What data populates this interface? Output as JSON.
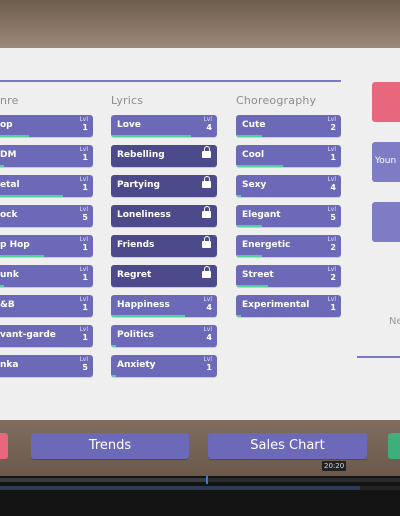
{
  "columns": {
    "genre": {
      "title": "nre",
      "items": [
        {
          "label": "op",
          "lvl_text": "Lvl",
          "level": "1",
          "progress": 0.35
        },
        {
          "label": "DM",
          "lvl_text": "Lvl",
          "level": "1",
          "progress": 0.1
        },
        {
          "label": "etal",
          "lvl_text": "Lvl",
          "level": "1",
          "progress": 0.7
        },
        {
          "label": "ock",
          "lvl_text": "Lvl",
          "level": "5",
          "progress": 0.05
        },
        {
          "label": "p Hop",
          "lvl_text": "Lvl",
          "level": "1",
          "progress": 0.5
        },
        {
          "label": "unk",
          "lvl_text": "Lvl",
          "level": "1",
          "progress": 0.1
        },
        {
          "label": "&B",
          "lvl_text": "Lvl",
          "level": "1",
          "progress": 0.05
        },
        {
          "label": "vant-garde",
          "lvl_text": "Lvl",
          "level": "1",
          "progress": 0.05
        },
        {
          "label": "nka",
          "lvl_text": "Lvl",
          "level": "5",
          "progress": 0.05
        }
      ]
    },
    "lyrics": {
      "title": "Lyrics",
      "items": [
        {
          "label": "Love",
          "lvl_text": "Lvl",
          "level": "4",
          "progress": 0.75,
          "locked": false
        },
        {
          "label": "Rebelling",
          "locked": true
        },
        {
          "label": "Partying",
          "locked": true
        },
        {
          "label": "Loneliness",
          "locked": true
        },
        {
          "label": "Friends",
          "locked": true
        },
        {
          "label": "Regret",
          "locked": true
        },
        {
          "label": "Happiness",
          "lvl_text": "Lvl",
          "level": "4",
          "progress": 0.7,
          "locked": false
        },
        {
          "label": "Politics",
          "lvl_text": "Lvl",
          "level": "4",
          "progress": 0.05,
          "locked": false
        },
        {
          "label": "Anxiety",
          "lvl_text": "Lvl",
          "level": "1",
          "progress": 0.05,
          "locked": false
        }
      ]
    },
    "choreography": {
      "title": "Choreography",
      "items": [
        {
          "label": "Cute",
          "lvl_text": "Lvl",
          "level": "2",
          "progress": 0.25
        },
        {
          "label": "Cool",
          "lvl_text": "Lvl",
          "level": "1",
          "progress": 0.45
        },
        {
          "label": "Sexy",
          "lvl_text": "Lvl",
          "level": "4",
          "progress": 0.05
        },
        {
          "label": "Elegant",
          "lvl_text": "Lvl",
          "level": "5",
          "progress": 0.25
        },
        {
          "label": "Energetic",
          "lvl_text": "Lvl",
          "level": "2",
          "progress": 0.25
        },
        {
          "label": "Street",
          "lvl_text": "Lvl",
          "level": "2",
          "progress": 0.3
        },
        {
          "label": "Experimental",
          "lvl_text": "Lvl",
          "level": "1",
          "progress": 0.05
        }
      ]
    }
  },
  "right_panel": {
    "button_label": "Youn",
    "partial_text": "Ne"
  },
  "bottom_bar": {
    "trends_label": "Trends",
    "sales_chart_label": "Sales Chart"
  },
  "timeline": {
    "time_tooltip": "20:20"
  },
  "colors": {
    "tile": "#6c6ab8",
    "tile_locked": "#4c4a8a",
    "progress": "#4fd39a",
    "accent_pink": "#e8677d",
    "accent_green": "#3fae7a"
  }
}
